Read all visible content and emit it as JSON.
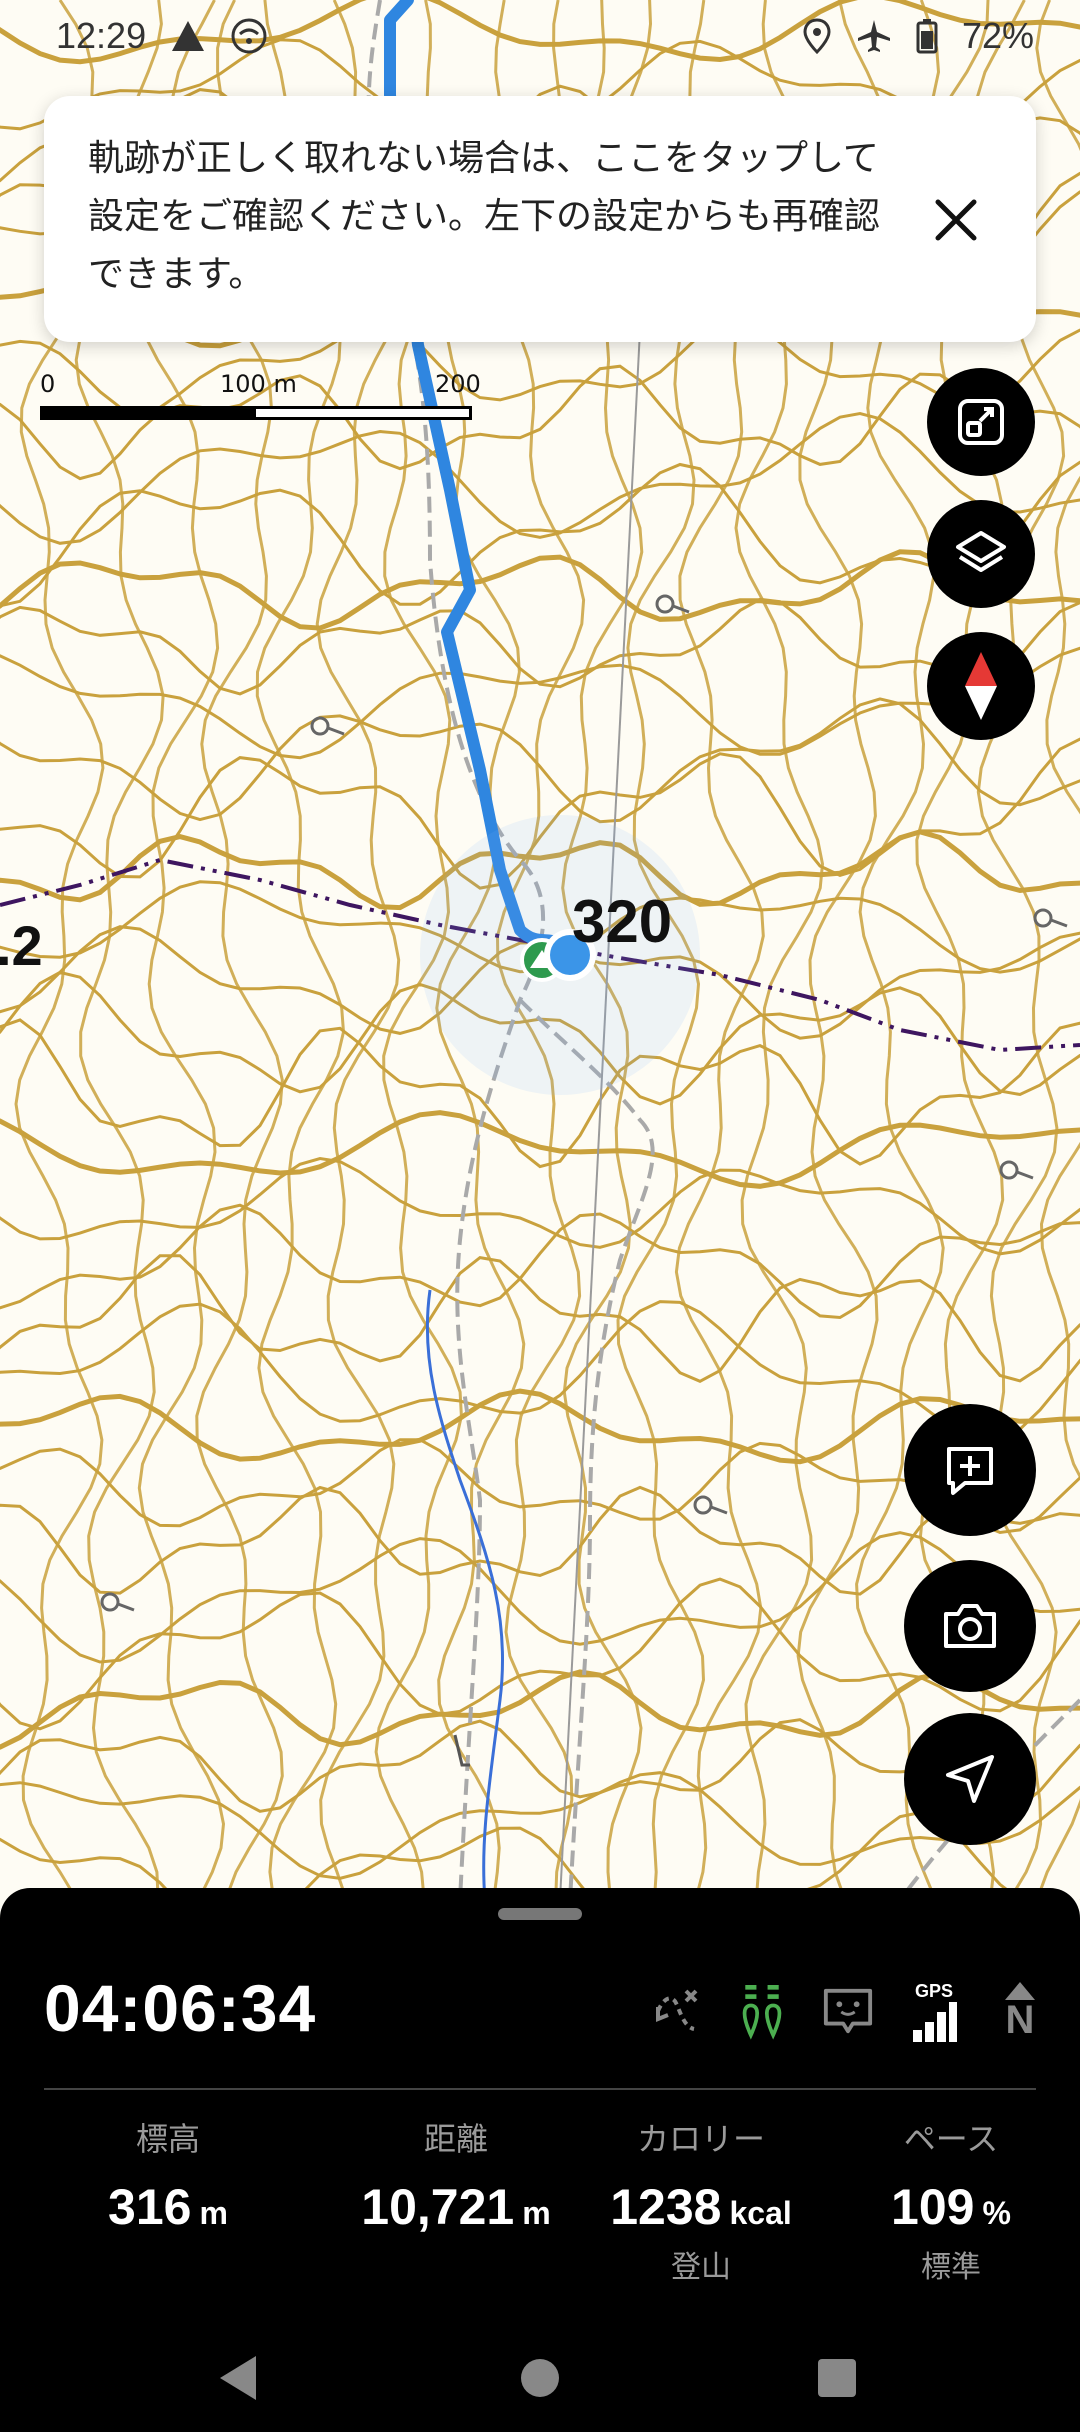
{
  "status_bar": {
    "time": "12:29",
    "battery": "72%",
    "icons": [
      "alert-icon",
      "wifi-icon",
      "location-icon",
      "airplane-icon",
      "battery-icon"
    ]
  },
  "notice": {
    "text": "軌跡が正しく取れない場合は、ここをタップして設定をご確認ください。左下の設定からも再確認できます。",
    "close_icon": "close-icon"
  },
  "scale_bar": {
    "labels": [
      "0",
      "100 m",
      "200 m"
    ]
  },
  "map": {
    "summit_label": "320",
    "edge_label": ".2",
    "colors": {
      "contour": "#c9a13d",
      "track": "#2f86e0",
      "trail": "#a9a9a9",
      "boundary": "#3e1660",
      "stream": "#3a6fd8",
      "location": "#3b95e8"
    }
  },
  "map_controls": [
    "fit-screen-icon",
    "layers-icon",
    "compass-icon",
    "add-memo-icon",
    "camera-icon",
    "navigate-icon"
  ],
  "panel": {
    "elapsed_time": "04:06:34",
    "status_icons": [
      "route-off-icon",
      "hikers-icon",
      "chat-face-icon",
      "gps-signal-icon",
      "north-up-icon"
    ],
    "gps_label": "GPS",
    "north_label": "N",
    "stats": [
      {
        "label": "標高",
        "value": "316",
        "unit": "m",
        "sub": ""
      },
      {
        "label": "距離",
        "value": "10,721",
        "unit": "m",
        "sub": ""
      },
      {
        "label": "カロリー",
        "value": "1238",
        "unit": "kcal",
        "sub": "登山"
      },
      {
        "label": "ペース",
        "value": "109",
        "unit": "%",
        "sub": "標準"
      }
    ]
  },
  "nav_bar": [
    "back-icon",
    "home-icon",
    "recents-icon"
  ]
}
